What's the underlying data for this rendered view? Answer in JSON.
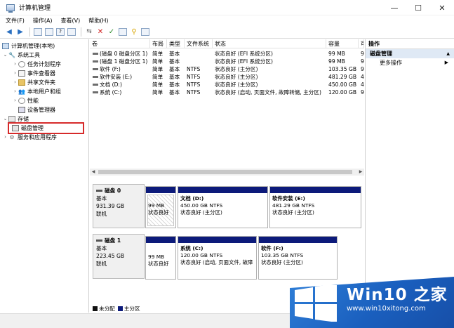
{
  "window": {
    "title": "计算机管理"
  },
  "menu": [
    "文件(F)",
    "操作(A)",
    "查看(V)",
    "帮助(H)"
  ],
  "tree": {
    "root": "计算机管理(本地)",
    "system_tools": "系统工具",
    "tasks": "任务计划程序",
    "events": "事件查看器",
    "shares": "共享文件夹",
    "users": "本地用户和组",
    "perf": "性能",
    "devices": "设备管理器",
    "storage": "存储",
    "disk_mgmt": "磁盘管理",
    "services": "服务和应用程序"
  },
  "columns": [
    "卷",
    "布局",
    "类型",
    "文件系统",
    "状态",
    "容量",
    "可"
  ],
  "volumes": [
    {
      "name": "(磁盘 0 磁盘分区 1)",
      "layout": "简单",
      "type": "基本",
      "fs": "",
      "status": "状态良好 (EFI 系统分区)",
      "capacity": "99 MB",
      "free": "9"
    },
    {
      "name": "(磁盘 1 磁盘分区 1)",
      "layout": "简单",
      "type": "基本",
      "fs": "",
      "status": "状态良好 (EFI 系统分区)",
      "capacity": "99 MB",
      "free": "9"
    },
    {
      "name": "软件 (F:)",
      "layout": "简单",
      "type": "基本",
      "fs": "NTFS",
      "status": "状态良好 (主分区)",
      "capacity": "103.35 GB",
      "free": "9"
    },
    {
      "name": "软件安装 (E:)",
      "layout": "简单",
      "type": "基本",
      "fs": "NTFS",
      "status": "状态良好 (主分区)",
      "capacity": "481.29 GB",
      "free": "4"
    },
    {
      "name": "文档 (D:)",
      "layout": "简单",
      "type": "基本",
      "fs": "NTFS",
      "status": "状态良好 (主分区)",
      "capacity": "450.00 GB",
      "free": "4"
    },
    {
      "name": "系统 (C:)",
      "layout": "简单",
      "type": "基本",
      "fs": "NTFS",
      "status": "状态良好 (启动, 页面文件, 故障转储, 主分区)",
      "capacity": "120.00 GB",
      "free": "9"
    }
  ],
  "disks": [
    {
      "name": "磁盘 0",
      "type": "基本",
      "size": "931.39 GB",
      "state": "联机",
      "parts": [
        {
          "title": "",
          "size": "99 MB",
          "status": "状态良好"
        },
        {
          "title": "文档 (D:)",
          "size": "450.00 GB NTFS",
          "status": "状态良好 (主分区)"
        },
        {
          "title": "软件安装 (E:)",
          "size": "481.29 GB NTFS",
          "status": "状态良好 (主分区)"
        }
      ]
    },
    {
      "name": "磁盘 1",
      "type": "基本",
      "size": "223.45 GB",
      "state": "联机",
      "parts": [
        {
          "title": "",
          "size": "99 MB",
          "status": "状态良好"
        },
        {
          "title": "系统 (C:)",
          "size": "120.00 GB NTFS",
          "status": "状态良好 (启动, 页面文件, 故障"
        },
        {
          "title": "软件 (F:)",
          "size": "103.35 GB NTFS",
          "status": "状态良好 (主分区)"
        }
      ]
    }
  ],
  "legend": {
    "unallocated": "未分配",
    "primary": "主分区"
  },
  "actions": {
    "header": "操作",
    "section": "磁盘管理",
    "more": "更多操作"
  },
  "watermark": {
    "title": "Win10 之家",
    "url": "www.win10xitong.com"
  },
  "colors": {
    "partition_bar": "#0c1a7a",
    "accent_blue": "#1a5fbe",
    "highlight": "#d62a2a"
  }
}
